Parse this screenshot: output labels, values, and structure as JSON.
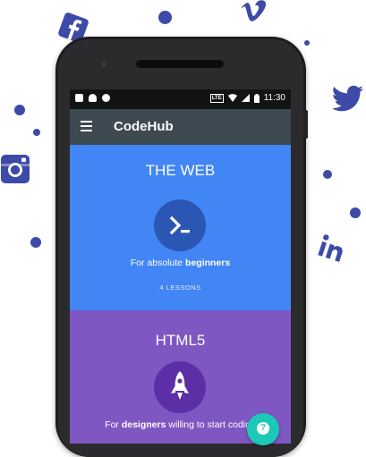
{
  "colors": {
    "accent_social": "#3d4aa8",
    "appbar": "#3d4a52",
    "card_web": "#4285f4",
    "card_html": "#7e57c2",
    "fab": "#1cc9b8"
  },
  "status_bar": {
    "time": "11:30",
    "network": "LTE"
  },
  "app_bar": {
    "title": "CodeHub",
    "menu_icon": "menu-icon"
  },
  "courses": [
    {
      "title": "THE WEB",
      "icon": "terminal-icon",
      "desc_prefix": "For absolute ",
      "desc_bold": "beginners",
      "meta": "4 LESSONS"
    },
    {
      "title": "HTML5",
      "icon": "rocket-icon",
      "desc_prefix": "For ",
      "desc_bold": "designers",
      "desc_suffix": " willing to start coding"
    }
  ],
  "fab": {
    "icon": "help-icon",
    "glyph": "?"
  },
  "social_icons": [
    "facebook-icon",
    "vimeo-icon",
    "twitter-icon",
    "instagram-icon",
    "linkedin-icon"
  ]
}
